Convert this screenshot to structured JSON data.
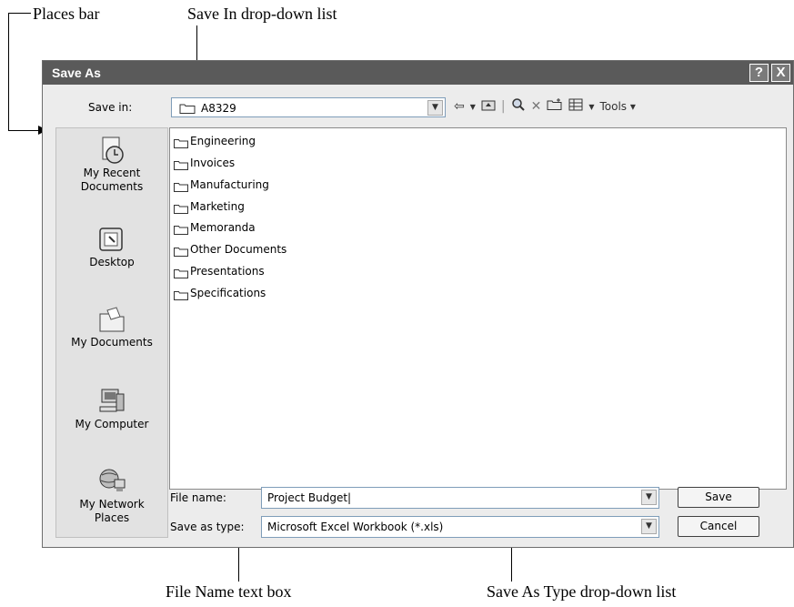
{
  "callouts": {
    "places_bar": "Places bar",
    "save_in": "Save In drop-down list",
    "file_name": "File Name text box",
    "save_as_type": "Save As Type drop-down list"
  },
  "dialog": {
    "title": "Save As",
    "help_button": "?",
    "close_button": "X"
  },
  "save_in": {
    "label": "Save in:",
    "value": "A8329"
  },
  "toolbar": {
    "back": "⇦",
    "up": "▲",
    "search": "🔍",
    "delete": "✕",
    "new_folder": "📁",
    "views": "▦",
    "tools_label": "Tools ▾"
  },
  "places": [
    {
      "label_line1": "My Recent",
      "label_line2": "Documents",
      "icon": "recent-documents-icon"
    },
    {
      "label_line1": "Desktop",
      "label_line2": "",
      "icon": "desktop-icon"
    },
    {
      "label_line1": "My Documents",
      "label_line2": "",
      "icon": "my-documents-icon"
    },
    {
      "label_line1": "My Computer",
      "label_line2": "",
      "icon": "my-computer-icon"
    },
    {
      "label_line1": "My Network",
      "label_line2": "Places",
      "icon": "network-places-icon"
    }
  ],
  "folders": [
    "Engineering",
    "Invoices",
    "Manufacturing",
    "Marketing",
    "Memoranda",
    "Other Documents",
    "Presentations",
    "Specifications"
  ],
  "file_name": {
    "label": "File name:",
    "value": "Project Budget|"
  },
  "save_as_type": {
    "label": "Save as type:",
    "value": "Microsoft Excel Workbook (*.xls)"
  },
  "buttons": {
    "save": "Save",
    "cancel": "Cancel"
  }
}
